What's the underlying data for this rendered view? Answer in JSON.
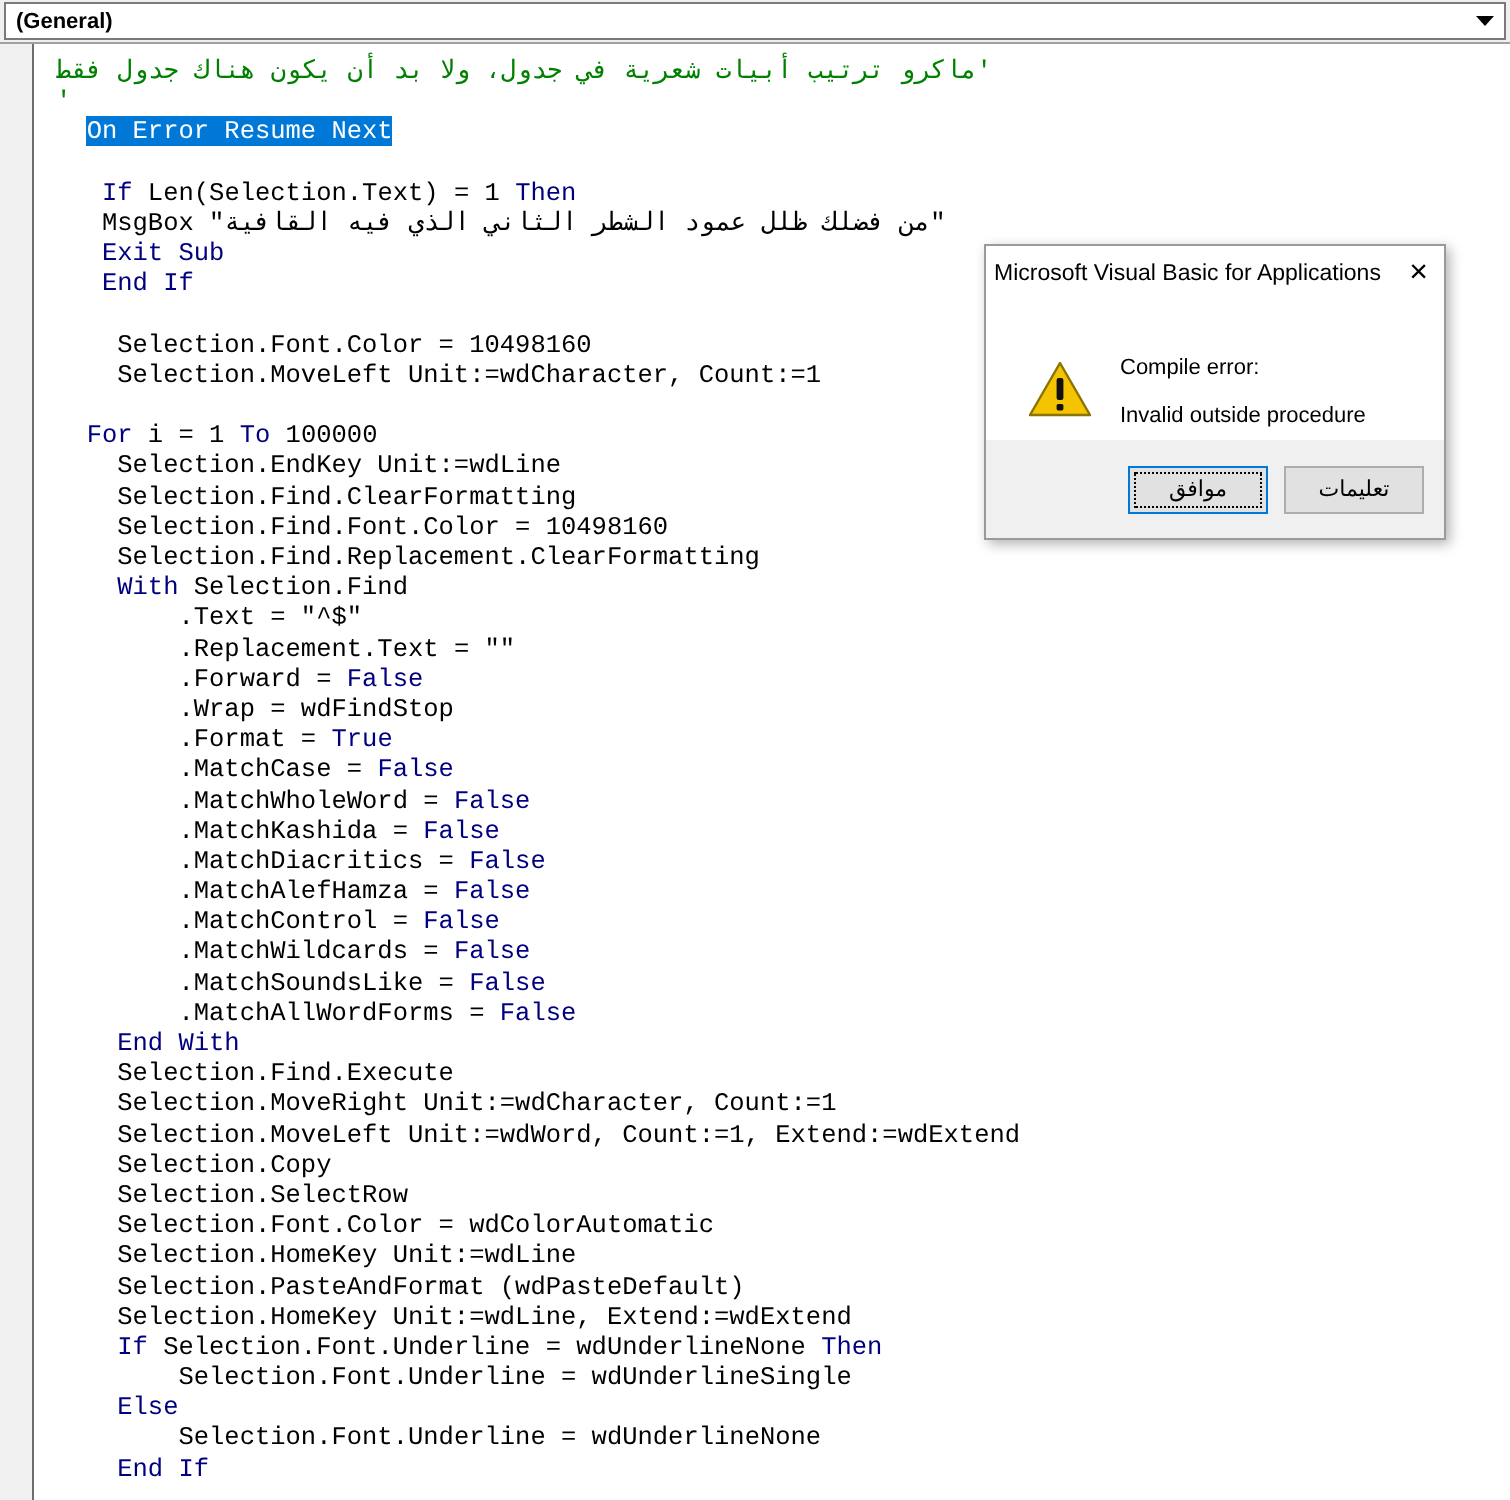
{
  "procedure_box": {
    "value": "(General)"
  },
  "code_lines": [
    {
      "kind": "code",
      "tokens": [
        {
          "kind": "comment",
          "text": "'ماكرو ترتيب أبيات شعرية في جدول، ولا بد أن يكون هناك جدول فقط",
          "rtl": true
        }
      ]
    },
    {
      "kind": "code",
      "tokens": [
        {
          "kind": "comment",
          "text": "'"
        }
      ]
    },
    {
      "kind": "code",
      "tokens": [
        {
          "kind": "selection",
          "text": "  On Error Resume Next"
        }
      ]
    },
    {
      "kind": "blank"
    },
    {
      "kind": "code",
      "tokens": [
        {
          "kind": "keyword",
          "text": "   If"
        },
        {
          "kind": "plain",
          "text": " Len(Selection.Text) = 1 "
        },
        {
          "kind": "keyword",
          "text": "Then"
        }
      ]
    },
    {
      "kind": "code",
      "tokens": [
        {
          "kind": "plain",
          "text": "   MsgBox \"من فضلك ظلل عمود الشطر الثاني الذي فيه القافية\""
        }
      ]
    },
    {
      "kind": "code",
      "tokens": [
        {
          "kind": "keyword",
          "text": "   Exit Sub"
        }
      ]
    },
    {
      "kind": "code",
      "tokens": [
        {
          "kind": "keyword",
          "text": "   End If"
        }
      ]
    },
    {
      "kind": "blank"
    },
    {
      "kind": "code",
      "tokens": [
        {
          "kind": "plain",
          "text": "    Selection.Font.Color = 10498160"
        }
      ]
    },
    {
      "kind": "code",
      "tokens": [
        {
          "kind": "plain",
          "text": "    Selection.MoveLeft Unit:=wdCharacter, Count:=1"
        }
      ]
    },
    {
      "kind": "blank"
    },
    {
      "kind": "code",
      "tokens": [
        {
          "kind": "keyword",
          "text": "  For"
        },
        {
          "kind": "plain",
          "text": " i = 1 "
        },
        {
          "kind": "keyword",
          "text": "To"
        },
        {
          "kind": "plain",
          "text": " 100000"
        }
      ]
    },
    {
      "kind": "code",
      "tokens": [
        {
          "kind": "plain",
          "text": "    Selection.EndKey Unit:=wdLine"
        }
      ]
    },
    {
      "kind": "code",
      "tokens": [
        {
          "kind": "plain",
          "text": "    Selection.Find.ClearFormatting"
        }
      ]
    },
    {
      "kind": "code",
      "tokens": [
        {
          "kind": "plain",
          "text": "    Selection.Find.Font.Color = 10498160"
        }
      ]
    },
    {
      "kind": "code",
      "tokens": [
        {
          "kind": "plain",
          "text": "    Selection.Find.Replacement.ClearFormatting"
        }
      ]
    },
    {
      "kind": "code",
      "tokens": [
        {
          "kind": "keyword",
          "text": "    With"
        },
        {
          "kind": "plain",
          "text": " Selection.Find"
        }
      ]
    },
    {
      "kind": "code",
      "tokens": [
        {
          "kind": "plain",
          "text": "        .Text = \"^$\""
        }
      ]
    },
    {
      "kind": "code",
      "tokens": [
        {
          "kind": "plain",
          "text": "        .Replacement.Text = \"\""
        }
      ]
    },
    {
      "kind": "code",
      "tokens": [
        {
          "kind": "plain",
          "text": "        .Forward = "
        },
        {
          "kind": "keyword",
          "text": "False"
        }
      ]
    },
    {
      "kind": "code",
      "tokens": [
        {
          "kind": "plain",
          "text": "        .Wrap = wdFindStop"
        }
      ]
    },
    {
      "kind": "code",
      "tokens": [
        {
          "kind": "plain",
          "text": "        .Format = "
        },
        {
          "kind": "keyword",
          "text": "True"
        }
      ]
    },
    {
      "kind": "code",
      "tokens": [
        {
          "kind": "plain",
          "text": "        .MatchCase = "
        },
        {
          "kind": "keyword",
          "text": "False"
        }
      ]
    },
    {
      "kind": "code",
      "tokens": [
        {
          "kind": "plain",
          "text": "        .MatchWholeWord = "
        },
        {
          "kind": "keyword",
          "text": "False"
        }
      ]
    },
    {
      "kind": "code",
      "tokens": [
        {
          "kind": "plain",
          "text": "        .MatchKashida = "
        },
        {
          "kind": "keyword",
          "text": "False"
        }
      ]
    },
    {
      "kind": "code",
      "tokens": [
        {
          "kind": "plain",
          "text": "        .MatchDiacritics = "
        },
        {
          "kind": "keyword",
          "text": "False"
        }
      ]
    },
    {
      "kind": "code",
      "tokens": [
        {
          "kind": "plain",
          "text": "        .MatchAlefHamza = "
        },
        {
          "kind": "keyword",
          "text": "False"
        }
      ]
    },
    {
      "kind": "code",
      "tokens": [
        {
          "kind": "plain",
          "text": "        .MatchControl = "
        },
        {
          "kind": "keyword",
          "text": "False"
        }
      ]
    },
    {
      "kind": "code",
      "tokens": [
        {
          "kind": "plain",
          "text": "        .MatchWildcards = "
        },
        {
          "kind": "keyword",
          "text": "False"
        }
      ]
    },
    {
      "kind": "code",
      "tokens": [
        {
          "kind": "plain",
          "text": "        .MatchSoundsLike = "
        },
        {
          "kind": "keyword",
          "text": "False"
        }
      ]
    },
    {
      "kind": "code",
      "tokens": [
        {
          "kind": "plain",
          "text": "        .MatchAllWordForms = "
        },
        {
          "kind": "keyword",
          "text": "False"
        }
      ]
    },
    {
      "kind": "code",
      "tokens": [
        {
          "kind": "keyword",
          "text": "    End With"
        }
      ]
    },
    {
      "kind": "code",
      "tokens": [
        {
          "kind": "plain",
          "text": "    Selection.Find.Execute"
        }
      ]
    },
    {
      "kind": "code",
      "tokens": [
        {
          "kind": "plain",
          "text": "    Selection.MoveRight Unit:=wdCharacter, Count:=1"
        }
      ]
    },
    {
      "kind": "code",
      "tokens": [
        {
          "kind": "plain",
          "text": "    Selection.MoveLeft Unit:=wdWord, Count:=1, Extend:=wdExtend"
        }
      ]
    },
    {
      "kind": "code",
      "tokens": [
        {
          "kind": "plain",
          "text": "    Selection.Copy"
        }
      ]
    },
    {
      "kind": "code",
      "tokens": [
        {
          "kind": "plain",
          "text": "    Selection.SelectRow"
        }
      ]
    },
    {
      "kind": "code",
      "tokens": [
        {
          "kind": "plain",
          "text": "    Selection.Font.Color = wdColorAutomatic"
        }
      ]
    },
    {
      "kind": "code",
      "tokens": [
        {
          "kind": "plain",
          "text": "    Selection.HomeKey Unit:=wdLine"
        }
      ]
    },
    {
      "kind": "code",
      "tokens": [
        {
          "kind": "plain",
          "text": "    Selection.PasteAndFormat (wdPasteDefault)"
        }
      ]
    },
    {
      "kind": "code",
      "tokens": [
        {
          "kind": "plain",
          "text": "    Selection.HomeKey Unit:=wdLine, Extend:=wdExtend"
        }
      ]
    },
    {
      "kind": "code",
      "tokens": [
        {
          "kind": "keyword",
          "text": "    If"
        },
        {
          "kind": "plain",
          "text": " Selection.Font.Underline = wdUnderlineNone "
        },
        {
          "kind": "keyword",
          "text": "Then"
        }
      ]
    },
    {
      "kind": "code",
      "tokens": [
        {
          "kind": "plain",
          "text": "        Selection.Font.Underline = wdUnderlineSingle"
        }
      ]
    },
    {
      "kind": "code",
      "tokens": [
        {
          "kind": "keyword",
          "text": "    Else"
        }
      ]
    },
    {
      "kind": "code",
      "tokens": [
        {
          "kind": "plain",
          "text": "        Selection.Font.Underline = wdUnderlineNone"
        }
      ]
    },
    {
      "kind": "code",
      "tokens": [
        {
          "kind": "keyword",
          "text": "    End If"
        }
      ]
    }
  ],
  "dialog": {
    "title": "Microsoft Visual Basic for Applications",
    "close": "×",
    "heading": "Compile error:",
    "message": "Invalid outside procedure",
    "buttons": [
      {
        "label": "تعليمات",
        "focused": false
      },
      {
        "label": "موافق",
        "focused": true
      }
    ]
  }
}
